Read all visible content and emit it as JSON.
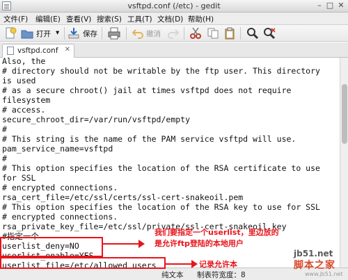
{
  "window": {
    "title": "vsftpd.conf (/etc) - gedit",
    "minimize_glyph": "–",
    "maximize_glyph": "□",
    "close_glyph": "✕"
  },
  "menu": [
    "文件(F)",
    "编辑(E)",
    "查看(V)",
    "搜索(S)",
    "工具(T)",
    "文档(D)",
    "帮助(H)"
  ],
  "toolbar": {
    "open_label": "打开",
    "save_label": "保存",
    "undo_label": "撤消",
    "dropdown_glyph": "▾"
  },
  "tab": {
    "label": "vsftpd.conf",
    "close_glyph": "✕"
  },
  "code_lines": [
    "Also, the",
    "# directory should not be writable by the ftp user. This directory",
    "is used",
    "# as a secure chroot() jail at times vsftpd does not require",
    "filesystem",
    "# access.",
    "secure_chroot_dir=/var/run/vsftpd/empty",
    "#",
    "# This string is the name of the PAM service vsftpd will use.",
    "pam_service_name=vsftpd",
    "#",
    "# This option specifies the location of the RSA certificate to use",
    "for SSL",
    "# encrypted connections.",
    "rsa_cert_file=/etc/ssl/certs/ssl-cert-snakeoil.pem",
    "# This option specifies the location of the RSA key to use for SSL",
    "# encrypted connections.",
    "rsa_private_key_file=/etc/ssl/private/ssl-cert-snakeoil.key",
    "#指定一个",
    "userlist_deny=NO",
    "userlist_enable=YES",
    "userlist_file=/etc/allowed_users"
  ],
  "status": {
    "language": "纯文本",
    "tab_width": "制表符宽度：8"
  },
  "annotations": {
    "note_line1": "我们要指定一个userlist，里边放的",
    "note_line2": "是允许ftp登陆的本地用户",
    "note_file": "记录允许本"
  },
  "watermark": {
    "site": "jb51.net",
    "cn": "脚本之家",
    "en": "www.jb51.net"
  },
  "colors": {
    "annotation_red": "#e8141b"
  }
}
